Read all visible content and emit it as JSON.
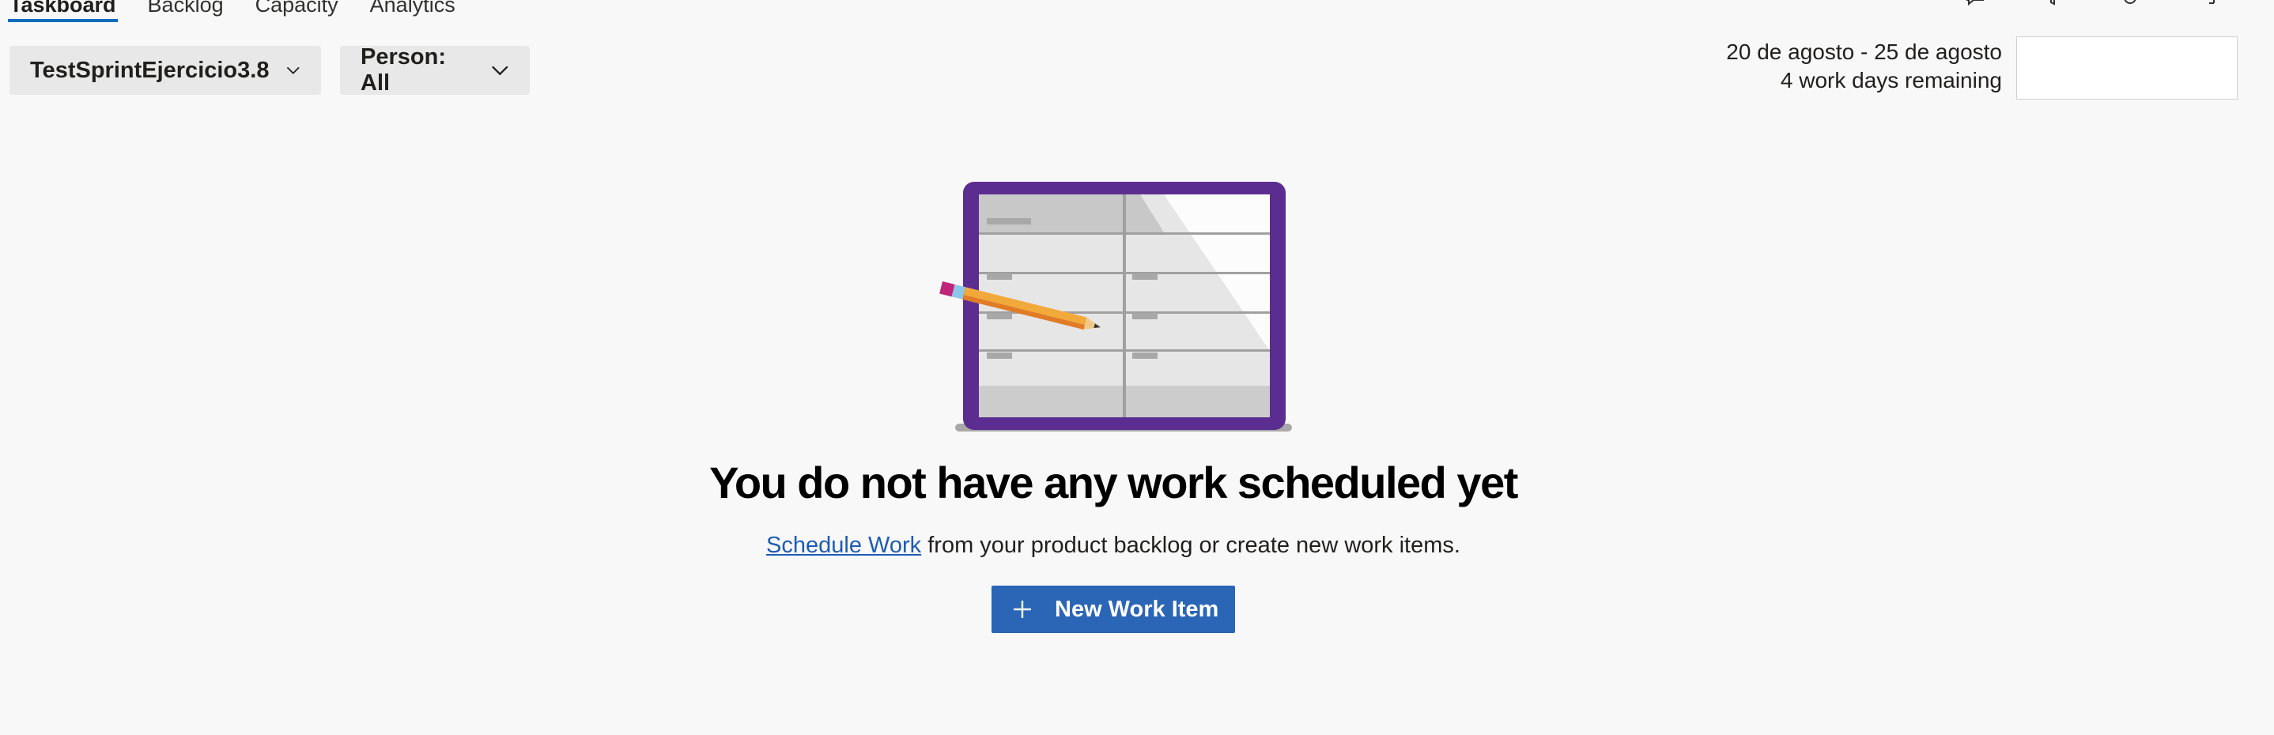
{
  "tabs": [
    {
      "label": "Taskboard",
      "active": true
    },
    {
      "label": "Backlog",
      "active": false
    },
    {
      "label": "Capacity",
      "active": false
    },
    {
      "label": "Analytics",
      "active": false
    }
  ],
  "top_icons": [
    "chat-icon",
    "filter-icon",
    "settings-icon",
    "expand-icon"
  ],
  "filters": {
    "sprint": {
      "label": "TestSprintEjercicio3.8",
      "icon": "chevron-down-icon"
    },
    "person": {
      "label": "Person: All",
      "icon": "chevron-down-icon"
    }
  },
  "sprint_info": {
    "dates": "20 de agosto - 25 de agosto",
    "remaining": "4 work days remaining"
  },
  "empty_state": {
    "title": "You do not have any work scheduled yet",
    "link": "Schedule Work",
    "message": " from your product backlog or create new work items.",
    "button_label": "New Work Item",
    "button_icon": "plus-icon"
  },
  "colors": {
    "accent": "#2b65b6",
    "tab_underline": "#0f6cbd",
    "link": "#1f5bb4",
    "illustration_frame": "#5c2d91",
    "pencil": "#f0a030"
  }
}
